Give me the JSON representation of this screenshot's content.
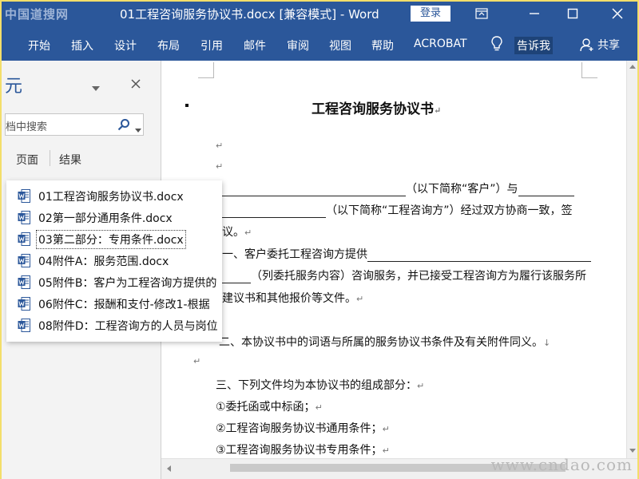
{
  "window": {
    "watermark_top": "中国道搜网",
    "title": "01工程咨询服务协议书.docx  [兼容模式]  -  Word",
    "login_label": "登录"
  },
  "ribbon": {
    "tabs": [
      "开始",
      "插入",
      "设计",
      "布局",
      "引用",
      "邮件",
      "审阅",
      "视图",
      "帮助",
      "ACROBAT"
    ],
    "tell_me": "告诉我",
    "share": "共享"
  },
  "navpane": {
    "title_fragment": "元",
    "search_text": "档中搜索",
    "tabs": [
      "页面",
      "结果"
    ]
  },
  "file_list": [
    "01工程咨询服务协议书.docx",
    "02第一部分通用条件.docx",
    "03第二部分：专用条件.docx",
    "04附件A：服务范围.docx",
    "05附件B：客户为工程咨询方提供的",
    "06附件C：报酬和支付-修改1-根据",
    "08附件D：工程咨询方的人员与岗位"
  ],
  "selected_file_index": 2,
  "document": {
    "heading": "工程咨询服务协议书",
    "lines": [
      "（以下简称“客户”）与",
      "（以下简称“工程咨询方”）经过双方协商一致，签",
      "议。",
      "一、客户委托工程咨询方提供",
      "（列委托服务内容）咨询服务，并已接受工程咨询方为履行该服务所",
      "建议书和其他报价等文件。",
      "二、本协议书中的词语与所属的服务协议书条件及有关附件同义。",
      "三、下列文件均为本协议书的组成部分：",
      "①委托函或中标函；",
      "②工程咨询服务协议书通用条件；",
      "③工程咨询服务协议书专用条件；"
    ]
  },
  "watermark_bottom": "www.cndao.com",
  "colors": {
    "ribbon": "#2b579a",
    "word_icon": "#2b579a"
  }
}
